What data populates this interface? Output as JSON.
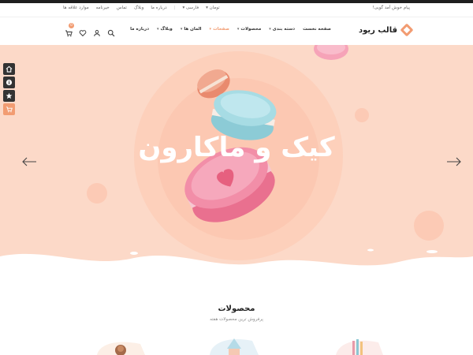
{
  "topbar": {
    "welcome": "پیام خوش آمد گویی!",
    "links": [
      "موارد علاقه ها",
      "خیرنامه",
      "تماس",
      "وبلاگ",
      "درباره ما"
    ],
    "language": "فارسی",
    "currency": "تومان"
  },
  "header": {
    "logo_text": "قالب ریود",
    "nav": [
      {
        "label": "صفحه نخست",
        "caret": false,
        "active": false
      },
      {
        "label": "دسته بندی",
        "caret": true,
        "active": false
      },
      {
        "label": "محصولات",
        "caret": true,
        "active": false
      },
      {
        "label": "صفحات",
        "caret": true,
        "active": true
      },
      {
        "label": "المان ها",
        "caret": true,
        "active": false
      },
      {
        "label": "وبلاگ",
        "caret": true,
        "active": false
      },
      {
        "label": "درباره ما",
        "caret": false,
        "active": false
      }
    ],
    "cart_count": "0",
    "icons": [
      "search-icon",
      "user-icon",
      "heart-icon",
      "cart-icon"
    ]
  },
  "hero": {
    "title": "کیک و ماکارون",
    "bg_color": "#fcd9c8"
  },
  "side_tools": [
    "home-icon",
    "info-icon",
    "star-icon",
    "cart-icon"
  ],
  "products": {
    "title": "محصولات",
    "subtitle": "پرفروش ترین محصولات هفته"
  },
  "colors": {
    "accent": "#f29c72",
    "dark": "#333333"
  }
}
